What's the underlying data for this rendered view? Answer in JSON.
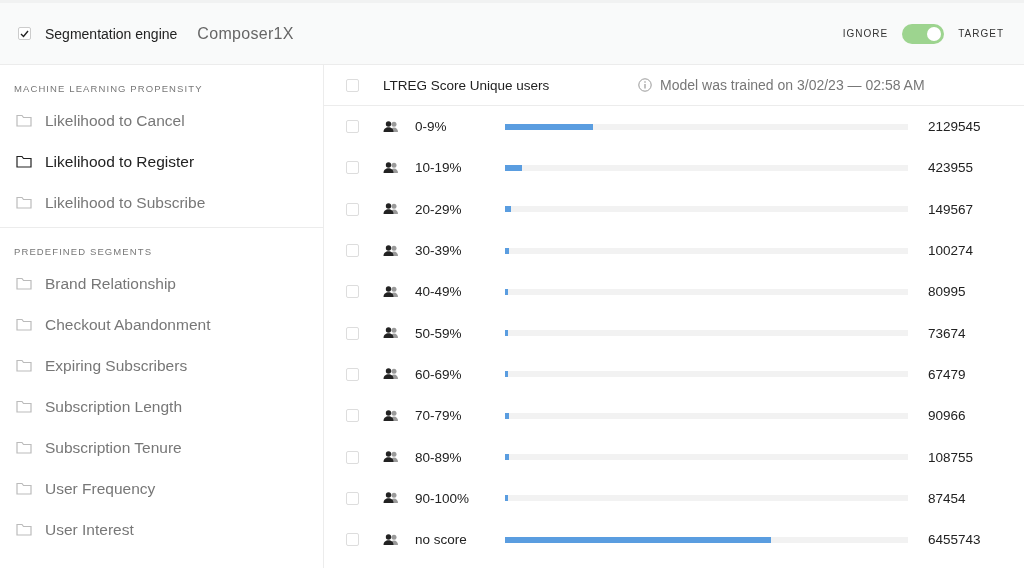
{
  "header": {
    "engine_checkbox": {
      "label": "Segmentation engine",
      "checked": true
    },
    "engine_name": "Composer1X",
    "toggle": {
      "left_label": "IGNORE",
      "right_label": "TARGET",
      "on": true
    }
  },
  "sidebar": {
    "sections": [
      {
        "heading": "MACHINE LEARNING PROPENSITY",
        "items": [
          {
            "label": "Likelihood to Cancel",
            "selected": false
          },
          {
            "label": "Likelihood to Register",
            "selected": true
          },
          {
            "label": "Likelihood to Subscribe",
            "selected": false
          }
        ]
      },
      {
        "heading": "PREDEFINED SEGMENTS",
        "items": [
          {
            "label": "Brand Relationship",
            "selected": false
          },
          {
            "label": "Checkout Abandonment",
            "selected": false
          },
          {
            "label": "Expiring Subscribers",
            "selected": false
          },
          {
            "label": "Subscription Length",
            "selected": false
          },
          {
            "label": "Subscription Tenure",
            "selected": false
          },
          {
            "label": "User Frequency",
            "selected": false
          },
          {
            "label": "User Interest",
            "selected": false
          }
        ]
      }
    ]
  },
  "table": {
    "header": {
      "checked": false,
      "title": "LTREG Score Unique users",
      "info": "Model was trained on 3/02/23 — 02:58 AM"
    },
    "rows": [
      {
        "checked": false,
        "range": "0-9%",
        "level": 0.218,
        "users": "2129545"
      },
      {
        "checked": false,
        "range": "10-19%",
        "level": 0.043,
        "users": "423955"
      },
      {
        "checked": false,
        "range": "20-29%",
        "level": 0.015,
        "users": "149567"
      },
      {
        "checked": false,
        "range": "30-39%",
        "level": 0.01,
        "users": "100274"
      },
      {
        "checked": false,
        "range": "40-49%",
        "level": 0.008,
        "users": "80995"
      },
      {
        "checked": false,
        "range": "50-59%",
        "level": 0.008,
        "users": "73674"
      },
      {
        "checked": false,
        "range": "60-69%",
        "level": 0.008,
        "users": "67479"
      },
      {
        "checked": false,
        "range": "70-79%",
        "level": 0.01,
        "users": "90966"
      },
      {
        "checked": false,
        "range": "80-89%",
        "level": 0.01,
        "users": "108755"
      },
      {
        "checked": false,
        "range": "90-100%",
        "level": 0.008,
        "users": "87454"
      },
      {
        "checked": false,
        "range": "no score",
        "level": 0.66,
        "users": "6455743"
      }
    ]
  }
}
